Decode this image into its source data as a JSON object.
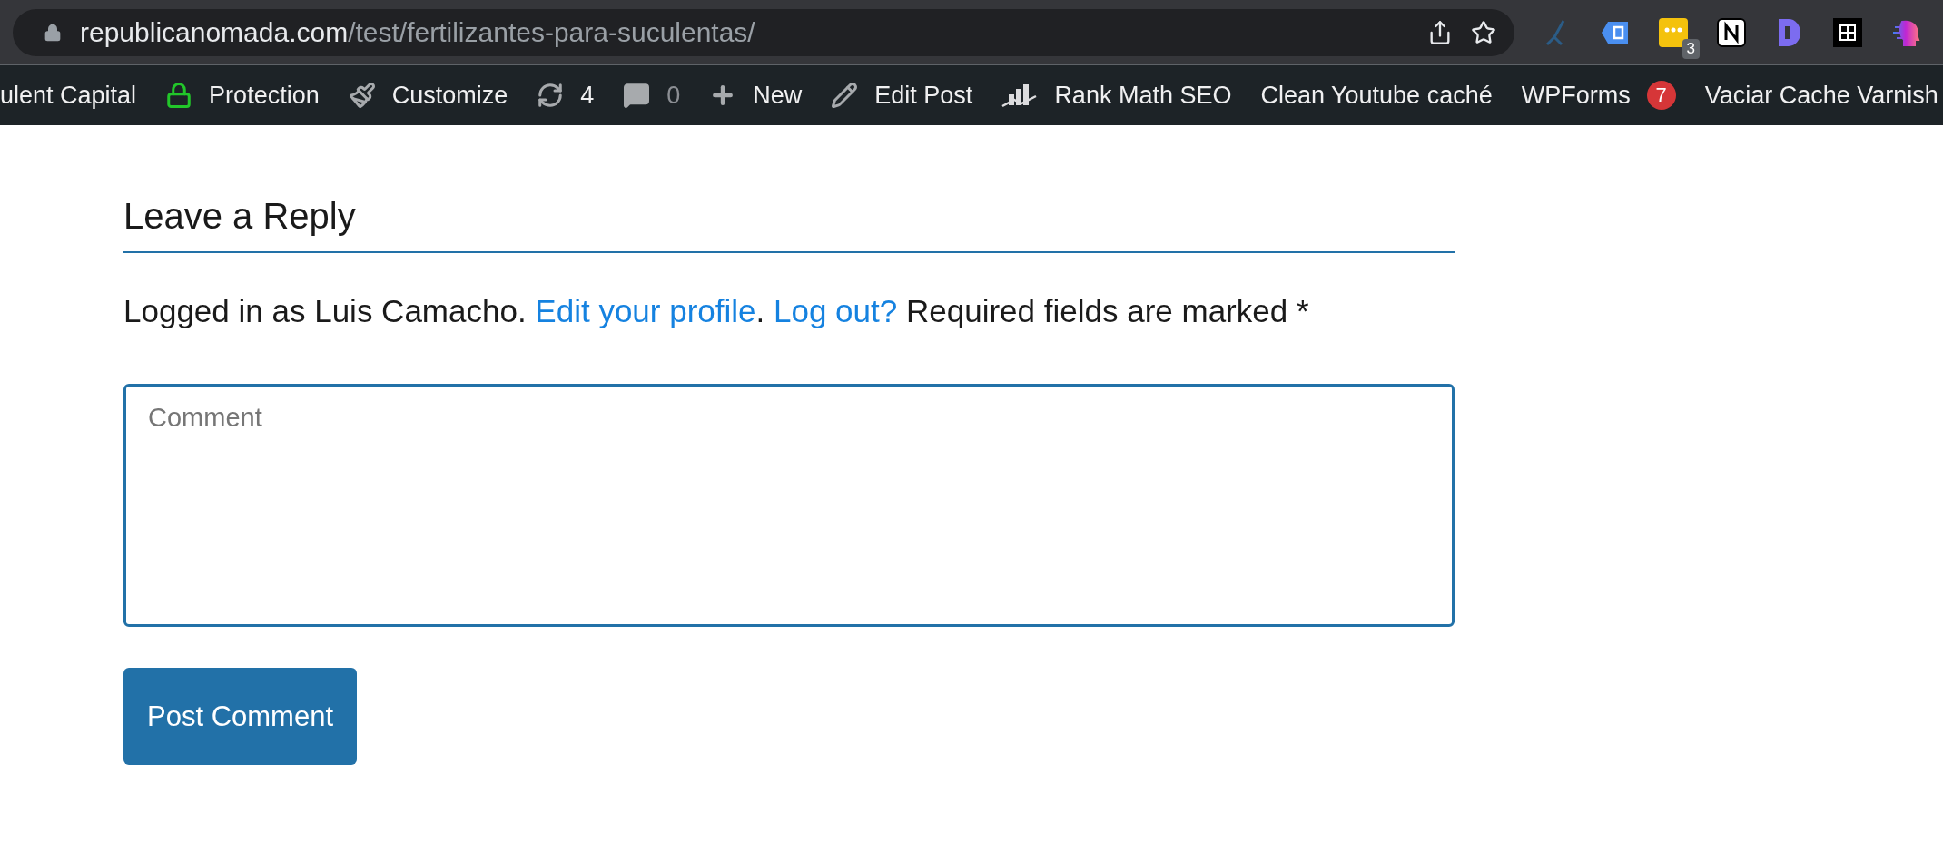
{
  "browser": {
    "url_host": "republicanomada.com",
    "url_path": "/test/fertilizantes-para-suculentas/",
    "extensions": [
      {
        "kind": "branch"
      },
      {
        "kind": "tag"
      },
      {
        "kind": "dots",
        "badge": "3"
      },
      {
        "kind": "notebook"
      },
      {
        "kind": "d-block"
      },
      {
        "kind": "grid"
      },
      {
        "kind": "head"
      }
    ]
  },
  "admin_bar": {
    "items": [
      {
        "kind": "text",
        "label": "ulent Capital",
        "muted": false
      },
      {
        "kind": "lock",
        "label": "Protection",
        "muted": false
      },
      {
        "kind": "brush",
        "label": "Customize",
        "muted": false
      },
      {
        "kind": "refresh",
        "label": "4",
        "muted": false
      },
      {
        "kind": "comment",
        "label": "0",
        "muted": true
      },
      {
        "kind": "plus",
        "label": "New",
        "muted": false
      },
      {
        "kind": "pencil",
        "label": "Edit Post",
        "muted": false
      },
      {
        "kind": "chart",
        "label": "Rank Math SEO",
        "muted": false
      },
      {
        "kind": "text",
        "label": "Clean Youtube caché",
        "muted": false
      },
      {
        "kind": "text",
        "label": "WPForms",
        "badge": "7",
        "muted": false
      },
      {
        "kind": "text",
        "label": "Vaciar Cache Varnish",
        "muted": false
      }
    ]
  },
  "reply": {
    "title": "Leave a Reply",
    "logged_in": "Logged in as Luis Camacho.",
    "edit_profile_link": "Edit your profile",
    "separator": ".",
    "logout_link": "Log out?",
    "required_note": "Required fields are marked *",
    "comment": {
      "placeholder": "Comment"
    },
    "submit": "Post Comment"
  }
}
